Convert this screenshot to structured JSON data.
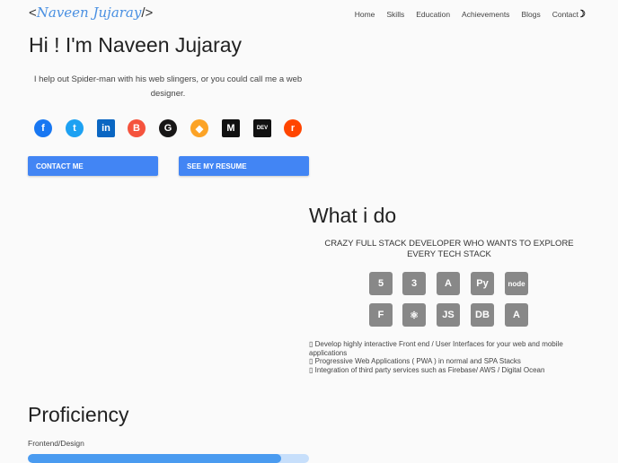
{
  "header": {
    "logo_prefix": "<",
    "logo_name": "Naveen Jujaray",
    "logo_suffix": "/>",
    "nav": [
      "Home",
      "Skills",
      "Education",
      "Achievements",
      "Blogs",
      "Contact"
    ],
    "theme_toggle": "☽"
  },
  "hero": {
    "title": "Hi ! I'm Naveen Jujaray",
    "intro": "I help out Spider-man with his web slingers, or you could call me a web designer.",
    "social": [
      {
        "name": "facebook",
        "glyph": "f",
        "color": "#1877f2"
      },
      {
        "name": "twitter",
        "glyph": "t",
        "color": "#1da1f2"
      },
      {
        "name": "linkedin",
        "glyph": "in",
        "color": "#0a66c2"
      },
      {
        "name": "blogger",
        "glyph": "B",
        "color": "#f5533d"
      },
      {
        "name": "github",
        "glyph": "G",
        "color": "#181717"
      },
      {
        "name": "gitlab",
        "glyph": "◆",
        "color": "#fca326"
      },
      {
        "name": "medium",
        "glyph": "M",
        "color": "#111111"
      },
      {
        "name": "dev",
        "glyph": "DEV",
        "color": "#111111"
      },
      {
        "name": "reddit",
        "glyph": "r",
        "color": "#ff4500"
      }
    ],
    "contact_button": "CONTACT ME",
    "resume_button": "SEE MY RESUME"
  },
  "what": {
    "title": "What i do",
    "subtitle": "CRAZY FULL STACK DEVELOPER WHO WANTS TO EXPLORE EVERY TECH STACK",
    "skills": [
      {
        "name": "html5",
        "glyph": "5"
      },
      {
        "name": "css3",
        "glyph": "3"
      },
      {
        "name": "android",
        "glyph": "A"
      },
      {
        "name": "python",
        "glyph": "Py"
      },
      {
        "name": "nodejs",
        "glyph": "node"
      },
      {
        "name": "firebase",
        "glyph": "F"
      },
      {
        "name": "react",
        "glyph": "⚛"
      },
      {
        "name": "javascript",
        "glyph": "JS"
      },
      {
        "name": "database",
        "glyph": "DB"
      },
      {
        "name": "adobe",
        "glyph": "A"
      }
    ],
    "points": [
      "Develop highly interactive Front end / User Interfaces for your web and mobile applications",
      "Progressive Web Applications ( PWA ) in normal and SPA Stacks",
      "Integration of third party services such as Firebase/ AWS / Digital Ocean"
    ]
  },
  "proficiency": {
    "title": "Proficiency",
    "items": [
      {
        "label": "Frontend/Design",
        "percent": 90
      }
    ]
  }
}
